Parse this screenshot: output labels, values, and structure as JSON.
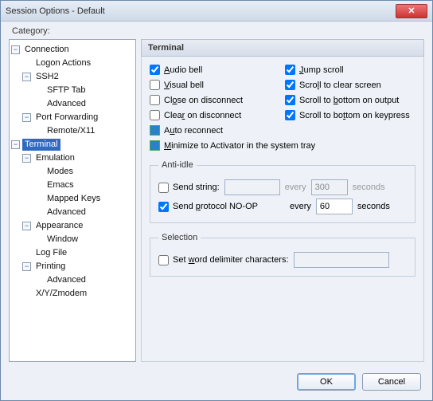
{
  "title": "Session Options - Default",
  "categoryLabel": "Category:",
  "tree": {
    "connection": "Connection",
    "logonActions": "Logon Actions",
    "ssh2": "SSH2",
    "sftpTab": "SFTP Tab",
    "advanced": "Advanced",
    "portForwarding": "Port Forwarding",
    "remoteX11": "Remote/X11",
    "terminal": "Terminal",
    "emulation": "Emulation",
    "modes": "Modes",
    "emacs": "Emacs",
    "mappedKeys": "Mapped Keys",
    "appearance": "Appearance",
    "window": "Window",
    "logFile": "Log File",
    "printing": "Printing",
    "xyzmodem": "X/Y/Zmodem"
  },
  "panel": {
    "title": "Terminal",
    "audioBell": {
      "u": "A",
      "r": "udio bell"
    },
    "jumpScroll": {
      "u": "J",
      "r": "ump scroll"
    },
    "visualBell": {
      "u": "V",
      "r": "isual bell"
    },
    "scrollClear": {
      "p": "Scro",
      "u": "l",
      "r": "l to clear screen"
    },
    "closeDisc": {
      "p": "Cl",
      "u": "o",
      "r": "se on disconnect"
    },
    "scrollOut": {
      "p": "Scroll to ",
      "u": "b",
      "r": "ottom on output"
    },
    "clearDisc": {
      "p": "Clea",
      "u": "r",
      "r": " on disconnect"
    },
    "scrollKey": {
      "p": "Scroll to bo",
      "u": "t",
      "r": "tom on keypress"
    },
    "autoReconn": {
      "p": "A",
      "u": "u",
      "r": "to reconnect"
    },
    "minTray": {
      "u": "M",
      "r": "inimize to Activator in the system tray"
    },
    "antiIdle": {
      "legend": "Anti-idle",
      "sendString": {
        "p": "Send strin",
        "u": "g",
        "r": ":"
      },
      "noop": {
        "p": "Send ",
        "u": "p",
        "r": "rotocol NO-OP"
      },
      "every": "every",
      "seconds": "seconds",
      "sendStringInterval": "300",
      "noopInterval": "60"
    },
    "selection": {
      "legend": "Selection",
      "wordDelim": {
        "p": "Set ",
        "u": "w",
        "r": "ord delimiter characters:"
      }
    }
  },
  "footer": {
    "ok": "OK",
    "cancel": "Cancel"
  }
}
